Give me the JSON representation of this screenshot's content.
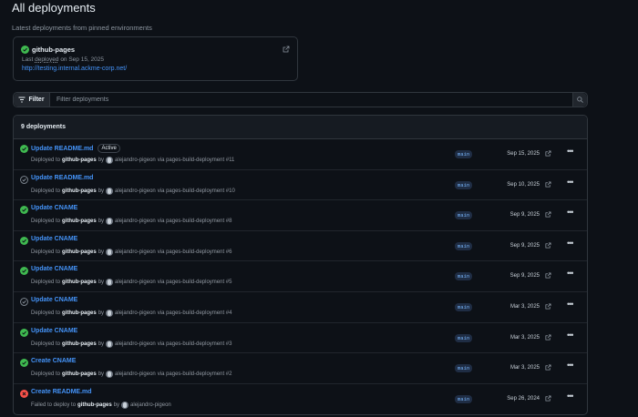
{
  "page": {
    "title": "All deployments"
  },
  "pinned": {
    "heading": "Latest deployments from pinned environments",
    "card": {
      "env_name": "github-pages",
      "meta_prefix": "Last",
      "meta_deployed": "deployed",
      "meta_suffix": "on Sep 15, 2025",
      "url": "http://testing.internal.ackme-corp.net/"
    }
  },
  "filter": {
    "button_label": "Filter",
    "placeholder": "Filter deployments"
  },
  "list": {
    "header": "9 deployments",
    "rows": [
      {
        "status": "success",
        "title": "Update README.md",
        "badge": "Active",
        "prefix": "Deployed to",
        "env": "github-pages",
        "by": "by",
        "user": "alejandro-pigeon",
        "via": "via pages-build-deployment #11",
        "branch": "main",
        "date": "Sep 15, 2025"
      },
      {
        "status": "inactive",
        "title": "Update README.md",
        "badge": "",
        "prefix": "Deployed to",
        "env": "github-pages",
        "by": "by",
        "user": "alejandro-pigeon",
        "via": "via pages-build-deployment #10",
        "branch": "main",
        "date": "Sep 10, 2025"
      },
      {
        "status": "success",
        "title": "Update CNAME",
        "badge": "",
        "prefix": "Deployed to",
        "env": "github-pages",
        "by": "by",
        "user": "alejandro-pigeon",
        "via": "via pages-build-deployment #8",
        "branch": "main",
        "date": "Sep 9, 2025"
      },
      {
        "status": "success",
        "title": "Update CNAME",
        "badge": "",
        "prefix": "Deployed to",
        "env": "github-pages",
        "by": "by",
        "user": "alejandro-pigeon",
        "via": "via pages-build-deployment #6",
        "branch": "main",
        "date": "Sep 9, 2025"
      },
      {
        "status": "success",
        "title": "Update CNAME",
        "badge": "",
        "prefix": "Deployed to",
        "env": "github-pages",
        "by": "by",
        "user": "alejandro-pigeon",
        "via": "via pages-build-deployment #5",
        "branch": "main",
        "date": "Sep 9, 2025"
      },
      {
        "status": "inactive",
        "title": "Update CNAME",
        "badge": "",
        "prefix": "Deployed to",
        "env": "github-pages",
        "by": "by",
        "user": "alejandro-pigeon",
        "via": "via pages-build-deployment #4",
        "branch": "main",
        "date": "Mar 3, 2025"
      },
      {
        "status": "success",
        "title": "Update CNAME",
        "badge": "",
        "prefix": "Deployed to",
        "env": "github-pages",
        "by": "by",
        "user": "alejandro-pigeon",
        "via": "via pages-build-deployment #3",
        "branch": "main",
        "date": "Mar 3, 2025"
      },
      {
        "status": "success",
        "title": "Create CNAME",
        "badge": "",
        "prefix": "Deployed to",
        "env": "github-pages",
        "by": "by",
        "user": "alejandro-pigeon",
        "via": "via pages-build-deployment #2",
        "branch": "main",
        "date": "Mar 3, 2025"
      },
      {
        "status": "failure",
        "title": "Create README.md",
        "badge": "",
        "prefix": "Failed to deploy to",
        "env": "github-pages",
        "by": "by",
        "user": "alejandro-pigeon",
        "via": "",
        "branch": "main",
        "date": "Sep 26, 2024"
      }
    ]
  },
  "colors": {
    "success": "#3fb950",
    "failure": "#f85149",
    "inactive": "#8b949e",
    "link": "#4493f8"
  },
  "icons": {
    "success": "check-circle-icon",
    "inactive": "check-circle-outline-icon",
    "failure": "x-circle-icon",
    "external": "external-link-icon",
    "more": "kebab-horizontal-icon",
    "filter": "filter-icon",
    "search": "search-icon"
  }
}
